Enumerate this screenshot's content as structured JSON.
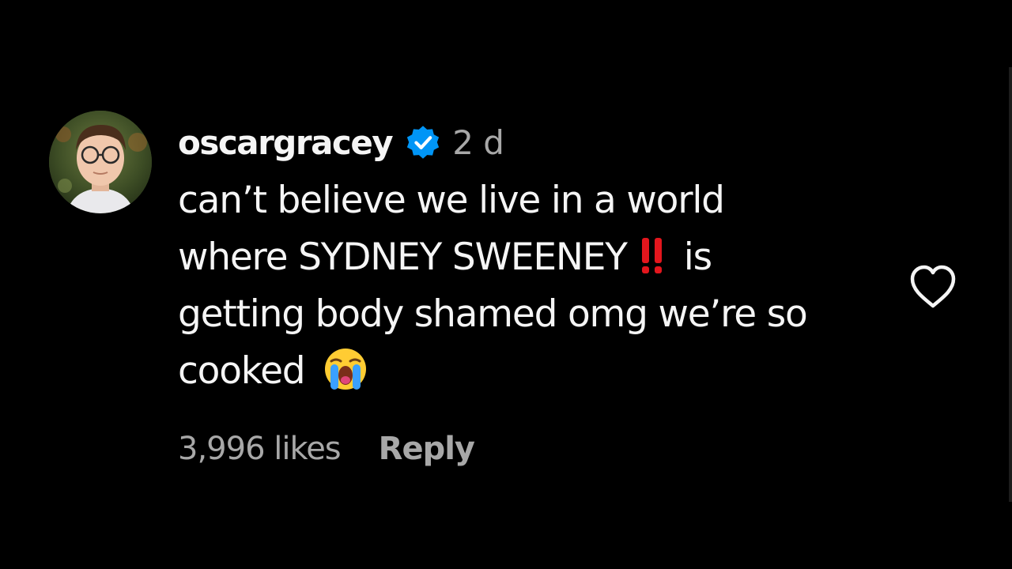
{
  "comment": {
    "username": "oscargracey",
    "verified_icon": "verified-badge-icon",
    "time": "2 d",
    "text_lines": [
      "can’t believe we live in a world",
      "where SYDNEY SWEENEY",
      "is",
      "getting body shamed omg we’re so",
      "cooked"
    ],
    "likes": "3,996 likes",
    "reply_label": "Reply",
    "emojis": [
      "double-exclamation-icon",
      "loudly-crying-face-icon"
    ],
    "heart_icon": "heart-outline-icon",
    "avatar_icon": "avatar-photo"
  },
  "colors": {
    "background": "#000000",
    "primary_text": "#f5f5f5",
    "secondary_text": "#a8a8a8",
    "verified_blue": "#0095f6"
  }
}
